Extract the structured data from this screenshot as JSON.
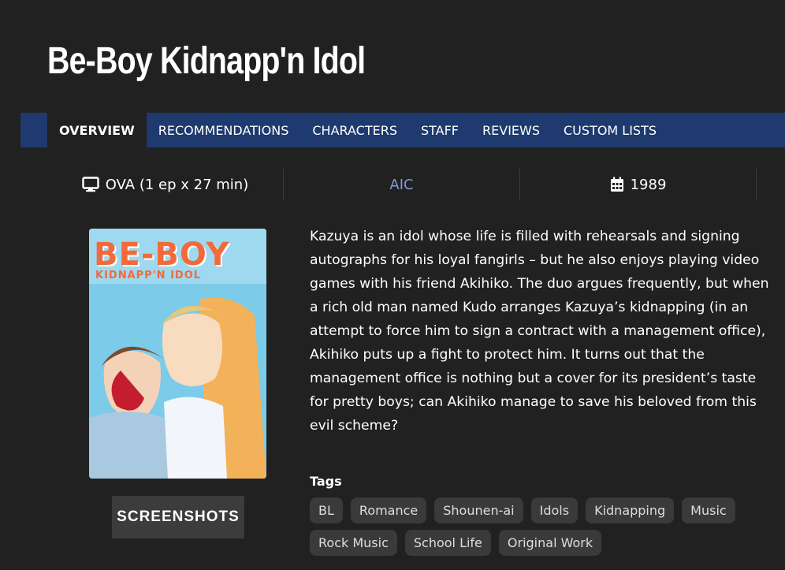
{
  "title": "Be-Boy Kidnapp'n Idol",
  "nav": {
    "tabs": [
      {
        "label": "OVERVIEW",
        "active": true
      },
      {
        "label": "RECOMMENDATIONS",
        "active": false
      },
      {
        "label": "CHARACTERS",
        "active": false
      },
      {
        "label": "STAFF",
        "active": false
      },
      {
        "label": "REVIEWS",
        "active": false
      },
      {
        "label": "CUSTOM LISTS",
        "active": false
      }
    ]
  },
  "info": {
    "type_icon": "monitor-icon",
    "type": "OVA (1 ep x 27 min)",
    "studio": "AIC",
    "year_icon": "calendar-icon",
    "year": "1989"
  },
  "cover": {
    "logo_text": "BE-BOY",
    "logo_subtext": "KIDNAPP'N IDOL"
  },
  "screenshots_label": "SCREENSHOTS",
  "synopsis": "Kazuya is an idol whose life is filled with rehearsals and signing autographs for his loyal fangirls – but he also enjoys playing video games with his friend Akihiko. The duo argues frequently, but when a rich old man named Kudo arranges Kazuya’s kidnapping (in an attempt to force him to sign a contract with a management office), Akihiko puts up a fight to protect him. It turns out that the management office is nothing but a cover for its president’s taste for pretty boys; can Akihiko manage to save his beloved from this evil scheme?",
  "tags_label": "Tags",
  "tags": [
    "BL",
    "Romance",
    "Shounen-ai",
    "Idols",
    "Kidnapping",
    "Music",
    "Rock Music",
    "School Life",
    "Original Work"
  ],
  "colors": {
    "background": "#212121",
    "nav_bar": "#1e3a6e",
    "link": "#7f9bd9",
    "tag_bg": "#3a3a3a",
    "button_bg": "#3c3c3c"
  }
}
